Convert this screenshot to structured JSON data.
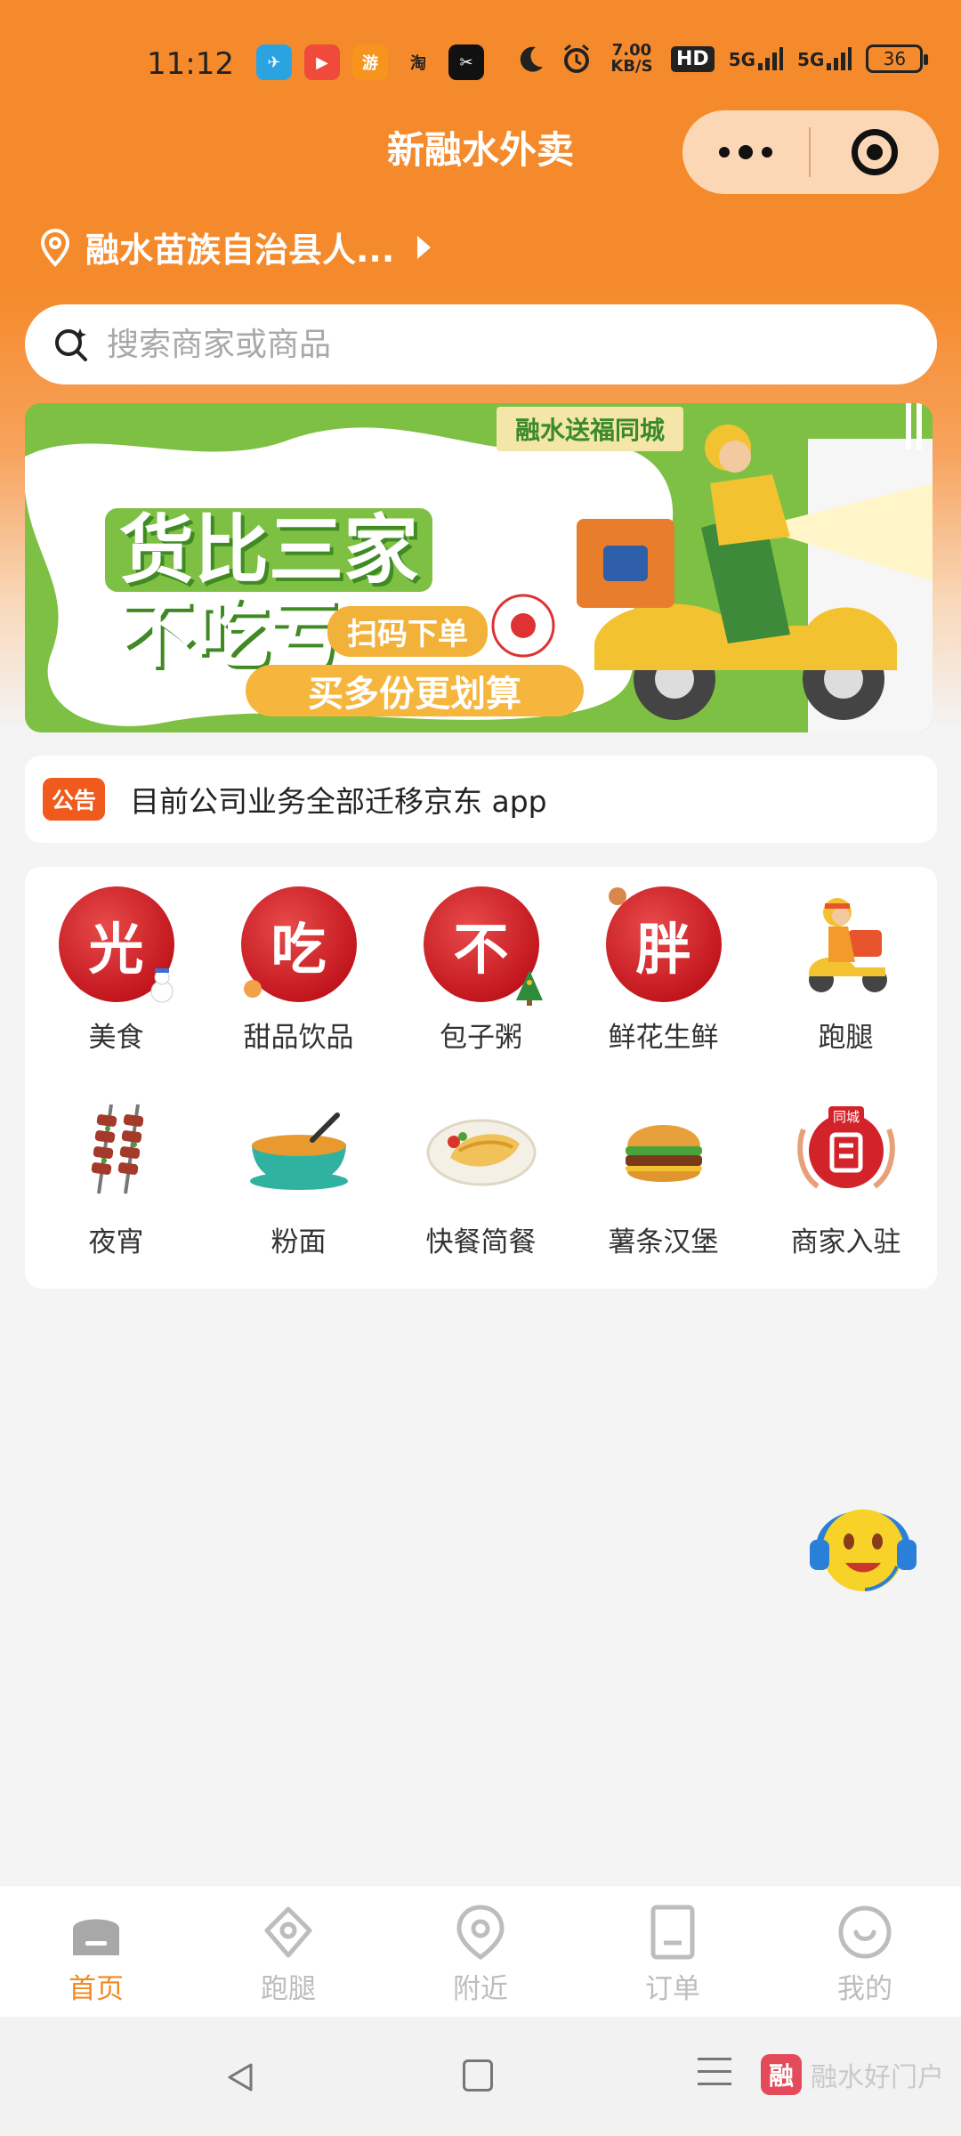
{
  "status_bar": {
    "time": "11:12",
    "app_icons": [
      {
        "name": "telegram-icon",
        "glyph": "✈",
        "color": "#2aa3e0"
      },
      {
        "name": "video-icon",
        "glyph": "▶",
        "color": "#f04a3a"
      },
      {
        "name": "game-icon",
        "glyph": "游",
        "color": "#f7941d"
      },
      {
        "name": "taobao-icon",
        "glyph": "淘",
        "color": "#222222"
      },
      {
        "name": "capcut-icon",
        "glyph": "✂",
        "color": "#111111"
      }
    ],
    "network_speed": "7.00 KB/S",
    "hd_label": "HD",
    "signal1": "5G",
    "signal2": "5G",
    "battery": "36"
  },
  "header": {
    "title": "新融水外卖"
  },
  "location": {
    "text": "融水苗族自治县人..."
  },
  "search": {
    "placeholder": "搜索商家或商品"
  },
  "banner": {
    "tag": "融水送福同城",
    "line1": "货比三家",
    "line2": "不吃亏",
    "chip": "扫码下单",
    "bottom": "买多份更划算"
  },
  "notice": {
    "badge": "公告",
    "text": "目前公司业务全部迁移京东 app"
  },
  "categories": [
    {
      "label": "美食",
      "glyph": "光",
      "icon": "food-icon"
    },
    {
      "label": "甜品饮品",
      "glyph": "吃",
      "icon": "dessert-icon"
    },
    {
      "label": "包子粥",
      "glyph": "不",
      "icon": "bun-icon"
    },
    {
      "label": "鲜花生鲜",
      "glyph": "胖",
      "icon": "fresh-icon"
    },
    {
      "label": "跑腿",
      "glyph": "",
      "icon": "errand-scooter-icon"
    },
    {
      "label": "夜宵",
      "glyph": "",
      "icon": "skewer-icon"
    },
    {
      "label": "粉面",
      "glyph": "",
      "icon": "noodle-bowl-icon"
    },
    {
      "label": "快餐简餐",
      "glyph": "",
      "icon": "fastfood-plate-icon"
    },
    {
      "label": "薯条汉堡",
      "glyph": "",
      "icon": "burger-icon"
    },
    {
      "label": "商家入驻",
      "glyph": "",
      "icon": "merchant-join-icon"
    }
  ],
  "tabbar": [
    {
      "label": "首页",
      "icon": "home-icon",
      "active": true
    },
    {
      "label": "跑腿",
      "icon": "errand-icon",
      "active": false
    },
    {
      "label": "附近",
      "icon": "nearby-icon",
      "active": false
    },
    {
      "label": "订单",
      "icon": "order-icon",
      "active": false
    },
    {
      "label": "我的",
      "icon": "profile-icon",
      "active": false
    }
  ],
  "watermark": {
    "logo": "融",
    "text": "融水好门户"
  },
  "colors": {
    "brand_orange": "#f58a2c",
    "active_tab": "#f08a24",
    "notice_badge": "#f05a1d"
  }
}
